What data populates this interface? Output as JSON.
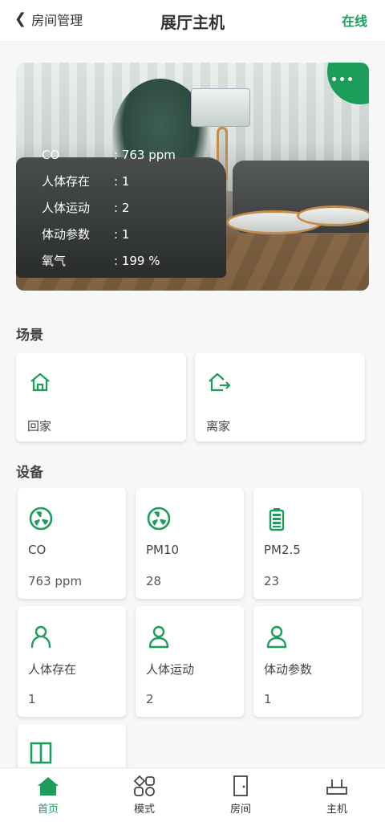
{
  "header": {
    "back_label": "房间管理",
    "title": "展厅主机",
    "status": "在线"
  },
  "hero": {
    "more_label": "•••",
    "readings": [
      {
        "key": "CO",
        "value": ": 763 ppm"
      },
      {
        "key": "人体存在",
        "value": ": 1"
      },
      {
        "key": "人体运动",
        "value": ": 2"
      },
      {
        "key": "体动参数",
        "value": ": 1"
      },
      {
        "key": "氧气",
        "value": ": 199 %"
      }
    ]
  },
  "scenes": {
    "title": "场景",
    "items": [
      {
        "label": "回家",
        "icon": "home-icon"
      },
      {
        "label": "离家",
        "icon": "leave-home-icon"
      }
    ]
  },
  "devices": {
    "title": "设备",
    "items": [
      {
        "name": "CO",
        "value": "763  ppm",
        "icon": "fan-icon"
      },
      {
        "name": "PM10",
        "value": "28",
        "icon": "fan-icon"
      },
      {
        "name": "PM2.5",
        "value": "23",
        "icon": "battery-icon"
      },
      {
        "name": "人体存在",
        "value": "1",
        "icon": "person-icon"
      },
      {
        "name": "人体运动",
        "value": "2",
        "icon": "person-icon"
      },
      {
        "name": "体动参数",
        "value": "1",
        "icon": "person-icon"
      }
    ]
  },
  "tabbar": {
    "items": [
      {
        "label": "首页",
        "icon": "home-filled-icon",
        "active": true
      },
      {
        "label": "模式",
        "icon": "mode-icon",
        "active": false
      },
      {
        "label": "房间",
        "icon": "door-icon",
        "active": false
      },
      {
        "label": "主机",
        "icon": "router-icon",
        "active": false
      }
    ]
  },
  "colors": {
    "accent": "#1a9e5a",
    "background": "#f7f7f7"
  }
}
